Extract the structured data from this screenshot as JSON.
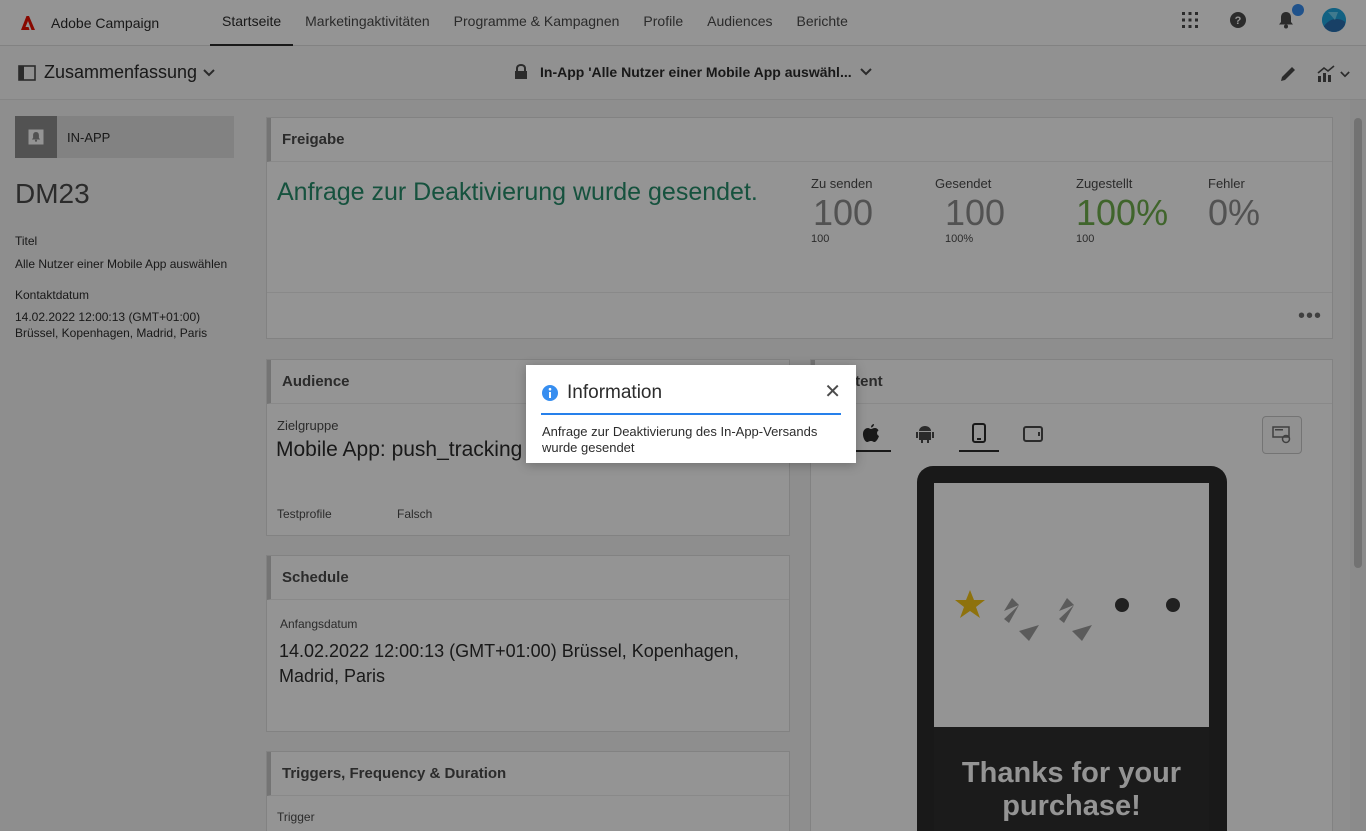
{
  "app": {
    "name": "Adobe Campaign",
    "brand_color": "#eb1000"
  },
  "nav": {
    "tabs": [
      {
        "label": "Startseite",
        "active": true
      },
      {
        "label": "Marketingaktivitäten",
        "active": false
      },
      {
        "label": "Programme & Kampagnen",
        "active": false
      },
      {
        "label": "Profile",
        "active": false
      },
      {
        "label": "Audiences",
        "active": false
      },
      {
        "label": "Berichte",
        "active": false
      }
    ],
    "icons": [
      "apps-grid-icon",
      "help-icon",
      "bell-icon",
      "avatar"
    ]
  },
  "subheader": {
    "summary_label": "Zusammenfassung",
    "title": "In-App 'Alle Nutzer einer Mobile App auswähl..."
  },
  "left": {
    "type_label": "IN-APP",
    "id": "DM23",
    "title_label": "Titel",
    "title_value": "Alle Nutzer einer Mobile App auswählen",
    "contact_label": "Kontaktdatum",
    "contact_value": "14.02.2022 12:00:13 (GMT+01:00) Brüssel, Kopenhagen, Madrid, Paris"
  },
  "release": {
    "header": "Freigabe",
    "status_message": "Anfrage zur Deaktivierung wurde gesendet.",
    "status_color": "#268e6c",
    "kpis": [
      {
        "label": "Zu senden",
        "value": "100",
        "sub": "100"
      },
      {
        "label": "Gesendet",
        "value": "100",
        "sub": "100%"
      },
      {
        "label": "Zugestellt",
        "value": "100%",
        "sub": "100",
        "color": "#6fae4d"
      },
      {
        "label": "Fehler",
        "value": "0%",
        "sub": ""
      }
    ],
    "more": "•••"
  },
  "audience": {
    "header": "Audience",
    "target_label": "Zielgruppe",
    "target_value": "Mobile App: push_tracking",
    "test_label": "Testprofile",
    "test_value": "Falsch"
  },
  "schedule": {
    "header": "Schedule",
    "start_label": "Anfangsdatum",
    "start_value": "14.02.2022 12:00:13 (GMT+01:00) Brüssel, Kopenhagen, Madrid, Paris"
  },
  "triggers": {
    "header": "Triggers, Frequency & Duration",
    "trigger_label": "Trigger"
  },
  "content": {
    "header": "Content",
    "preview_text": "Thanks for your purchase!"
  },
  "dialog": {
    "title": "Information",
    "message": "Anfrage zur Deaktivierung des In-App-Versands wurde gesendet",
    "close": "✕"
  }
}
